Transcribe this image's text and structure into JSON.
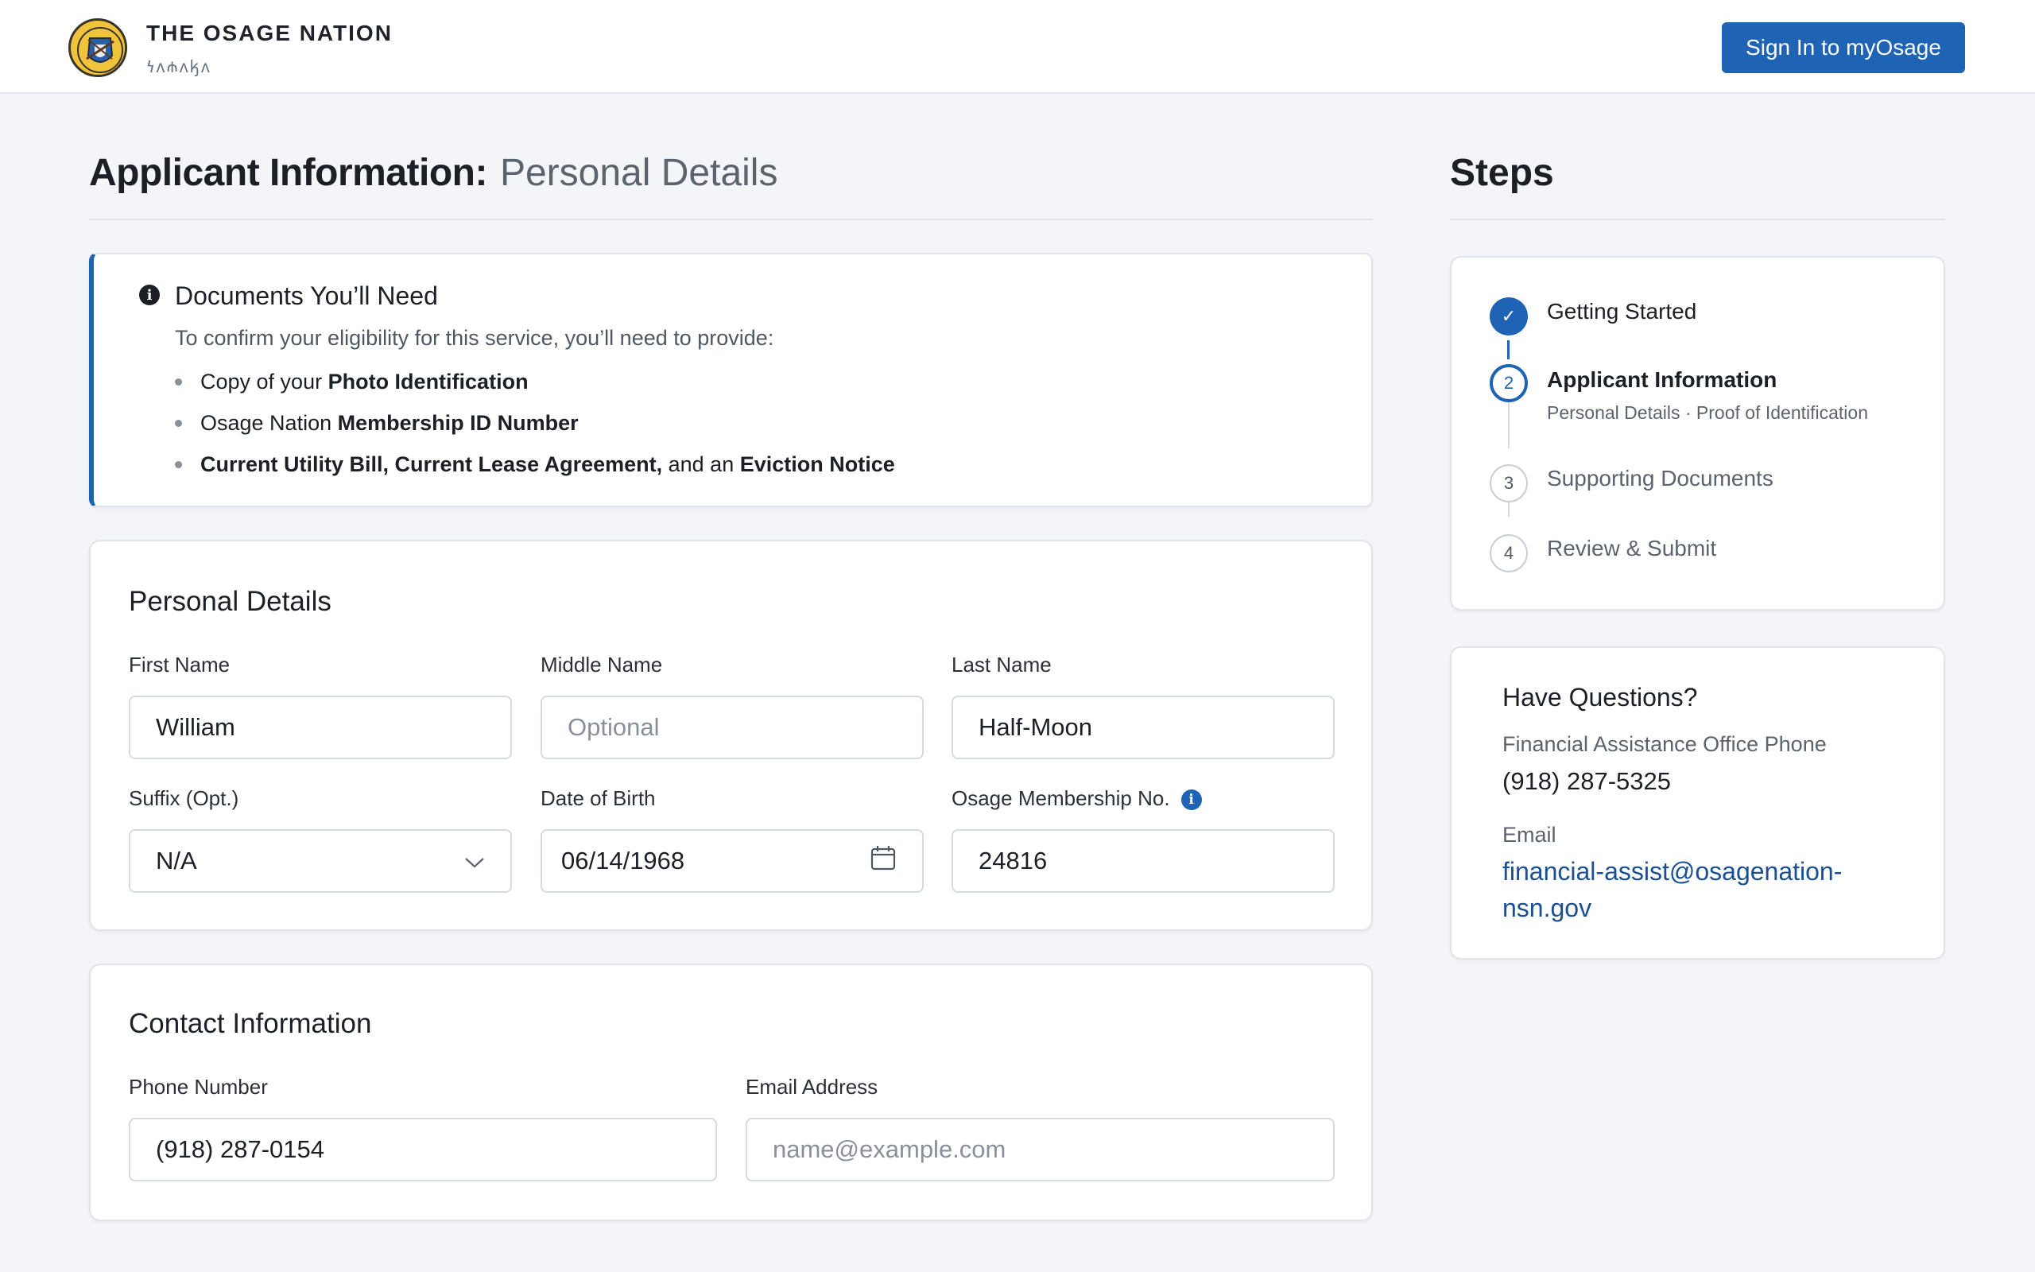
{
  "header": {
    "brand_name": "THE OSAGE NATION",
    "brand_subtitle": "𐓏𐓘𐓸𐓘𐓤𐓘",
    "signin_label": "Sign In to myOsage"
  },
  "page": {
    "title_bold": "Applicant Information:",
    "title_light": "Personal Details"
  },
  "docs": {
    "title": "Documents You’ll Need",
    "intro": "To confirm your eligibility for this service, you’ll need to provide:",
    "item1_prefix": "Copy of your ",
    "item1_bold": "Photo Identification",
    "item2_prefix": "Osage Nation ",
    "item2_bold": "Membership ID Number",
    "item3_bold1": "Current Utility Bill, Current Lease Agreement,",
    "item3_mid": " and an ",
    "item3_bold2": "Eviction Notice"
  },
  "personal": {
    "section_title": "Personal Details",
    "first_name_label": "First Name",
    "first_name_value": "William",
    "middle_name_label": "Middle Name",
    "middle_name_placeholder": "Optional",
    "last_name_label": "Last Name",
    "last_name_value": "Half-Moon",
    "suffix_label": "Suffix (Opt.)",
    "suffix_value": "N/A",
    "dob_label": "Date of Birth",
    "dob_value": "06/14/1968",
    "membership_label": "Osage Membership No.",
    "membership_value": "24816"
  },
  "contact": {
    "section_title": "Contact Information",
    "phone_label": "Phone Number",
    "phone_value": "(918) 287-0154",
    "email_label": "Email Address",
    "email_placeholder": "name@example.com"
  },
  "steps": {
    "title": "Steps",
    "items": [
      {
        "number": "✓",
        "label": "Getting Started",
        "status": "done"
      },
      {
        "number": "2",
        "label": "Applicant Information",
        "sub": "Personal Details · Proof of Identification",
        "status": "current"
      },
      {
        "number": "3",
        "label": "Supporting Documents",
        "status": "todo"
      },
      {
        "number": "4",
        "label": "Review & Submit",
        "status": "todo"
      }
    ]
  },
  "questions": {
    "title": "Have Questions?",
    "phone_label": "Financial Assistance Office Phone",
    "phone_value": "(918) 287-5325",
    "email_label": "Email",
    "email_value": "financial-assist@osagenation-nsn.gov"
  },
  "colors": {
    "accent": "#1f63b5",
    "background": "#f3f5f9",
    "link": "#1a4f93",
    "logo_gold": "#f0c33c"
  }
}
